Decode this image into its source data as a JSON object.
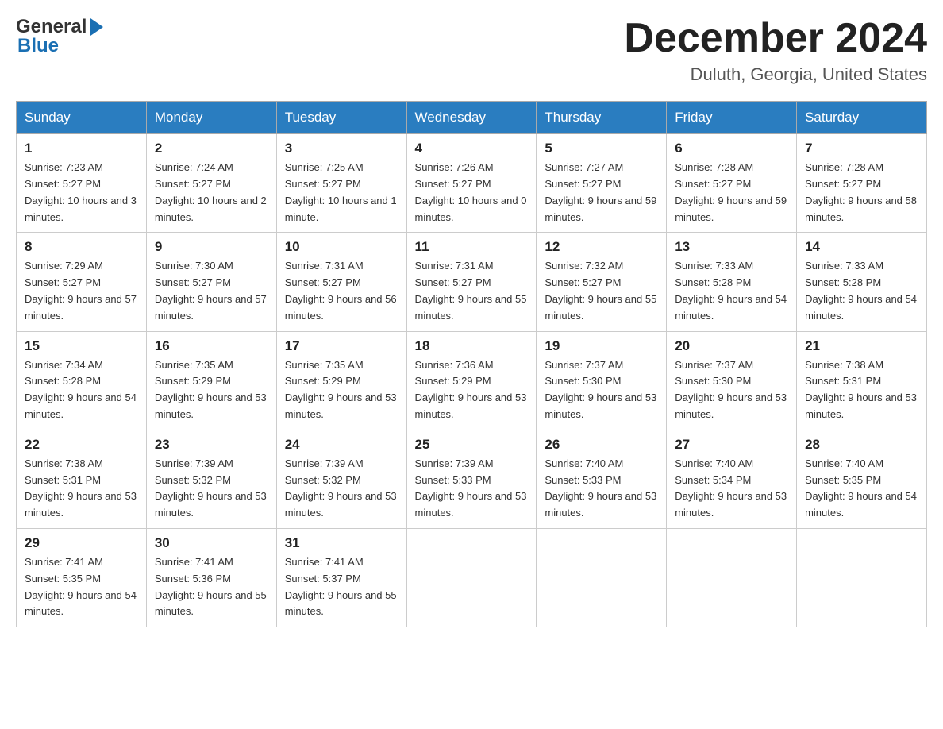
{
  "header": {
    "logo_general": "General",
    "logo_blue": "Blue",
    "month_title": "December 2024",
    "location": "Duluth, Georgia, United States"
  },
  "weekdays": [
    "Sunday",
    "Monday",
    "Tuesday",
    "Wednesday",
    "Thursday",
    "Friday",
    "Saturday"
  ],
  "weeks": [
    [
      {
        "day": "1",
        "sunrise": "7:23 AM",
        "sunset": "5:27 PM",
        "daylight": "10 hours and 3 minutes."
      },
      {
        "day": "2",
        "sunrise": "7:24 AM",
        "sunset": "5:27 PM",
        "daylight": "10 hours and 2 minutes."
      },
      {
        "day": "3",
        "sunrise": "7:25 AM",
        "sunset": "5:27 PM",
        "daylight": "10 hours and 1 minute."
      },
      {
        "day": "4",
        "sunrise": "7:26 AM",
        "sunset": "5:27 PM",
        "daylight": "10 hours and 0 minutes."
      },
      {
        "day": "5",
        "sunrise": "7:27 AM",
        "sunset": "5:27 PM",
        "daylight": "9 hours and 59 minutes."
      },
      {
        "day": "6",
        "sunrise": "7:28 AM",
        "sunset": "5:27 PM",
        "daylight": "9 hours and 59 minutes."
      },
      {
        "day": "7",
        "sunrise": "7:28 AM",
        "sunset": "5:27 PM",
        "daylight": "9 hours and 58 minutes."
      }
    ],
    [
      {
        "day": "8",
        "sunrise": "7:29 AM",
        "sunset": "5:27 PM",
        "daylight": "9 hours and 57 minutes."
      },
      {
        "day": "9",
        "sunrise": "7:30 AM",
        "sunset": "5:27 PM",
        "daylight": "9 hours and 57 minutes."
      },
      {
        "day": "10",
        "sunrise": "7:31 AM",
        "sunset": "5:27 PM",
        "daylight": "9 hours and 56 minutes."
      },
      {
        "day": "11",
        "sunrise": "7:31 AM",
        "sunset": "5:27 PM",
        "daylight": "9 hours and 55 minutes."
      },
      {
        "day": "12",
        "sunrise": "7:32 AM",
        "sunset": "5:27 PM",
        "daylight": "9 hours and 55 minutes."
      },
      {
        "day": "13",
        "sunrise": "7:33 AM",
        "sunset": "5:28 PM",
        "daylight": "9 hours and 54 minutes."
      },
      {
        "day": "14",
        "sunrise": "7:33 AM",
        "sunset": "5:28 PM",
        "daylight": "9 hours and 54 minutes."
      }
    ],
    [
      {
        "day": "15",
        "sunrise": "7:34 AM",
        "sunset": "5:28 PM",
        "daylight": "9 hours and 54 minutes."
      },
      {
        "day": "16",
        "sunrise": "7:35 AM",
        "sunset": "5:29 PM",
        "daylight": "9 hours and 53 minutes."
      },
      {
        "day": "17",
        "sunrise": "7:35 AM",
        "sunset": "5:29 PM",
        "daylight": "9 hours and 53 minutes."
      },
      {
        "day": "18",
        "sunrise": "7:36 AM",
        "sunset": "5:29 PM",
        "daylight": "9 hours and 53 minutes."
      },
      {
        "day": "19",
        "sunrise": "7:37 AM",
        "sunset": "5:30 PM",
        "daylight": "9 hours and 53 minutes."
      },
      {
        "day": "20",
        "sunrise": "7:37 AM",
        "sunset": "5:30 PM",
        "daylight": "9 hours and 53 minutes."
      },
      {
        "day": "21",
        "sunrise": "7:38 AM",
        "sunset": "5:31 PM",
        "daylight": "9 hours and 53 minutes."
      }
    ],
    [
      {
        "day": "22",
        "sunrise": "7:38 AM",
        "sunset": "5:31 PM",
        "daylight": "9 hours and 53 minutes."
      },
      {
        "day": "23",
        "sunrise": "7:39 AM",
        "sunset": "5:32 PM",
        "daylight": "9 hours and 53 minutes."
      },
      {
        "day": "24",
        "sunrise": "7:39 AM",
        "sunset": "5:32 PM",
        "daylight": "9 hours and 53 minutes."
      },
      {
        "day": "25",
        "sunrise": "7:39 AM",
        "sunset": "5:33 PM",
        "daylight": "9 hours and 53 minutes."
      },
      {
        "day": "26",
        "sunrise": "7:40 AM",
        "sunset": "5:33 PM",
        "daylight": "9 hours and 53 minutes."
      },
      {
        "day": "27",
        "sunrise": "7:40 AM",
        "sunset": "5:34 PM",
        "daylight": "9 hours and 53 minutes."
      },
      {
        "day": "28",
        "sunrise": "7:40 AM",
        "sunset": "5:35 PM",
        "daylight": "9 hours and 54 minutes."
      }
    ],
    [
      {
        "day": "29",
        "sunrise": "7:41 AM",
        "sunset": "5:35 PM",
        "daylight": "9 hours and 54 minutes."
      },
      {
        "day": "30",
        "sunrise": "7:41 AM",
        "sunset": "5:36 PM",
        "daylight": "9 hours and 55 minutes."
      },
      {
        "day": "31",
        "sunrise": "7:41 AM",
        "sunset": "5:37 PM",
        "daylight": "9 hours and 55 minutes."
      },
      null,
      null,
      null,
      null
    ]
  ]
}
